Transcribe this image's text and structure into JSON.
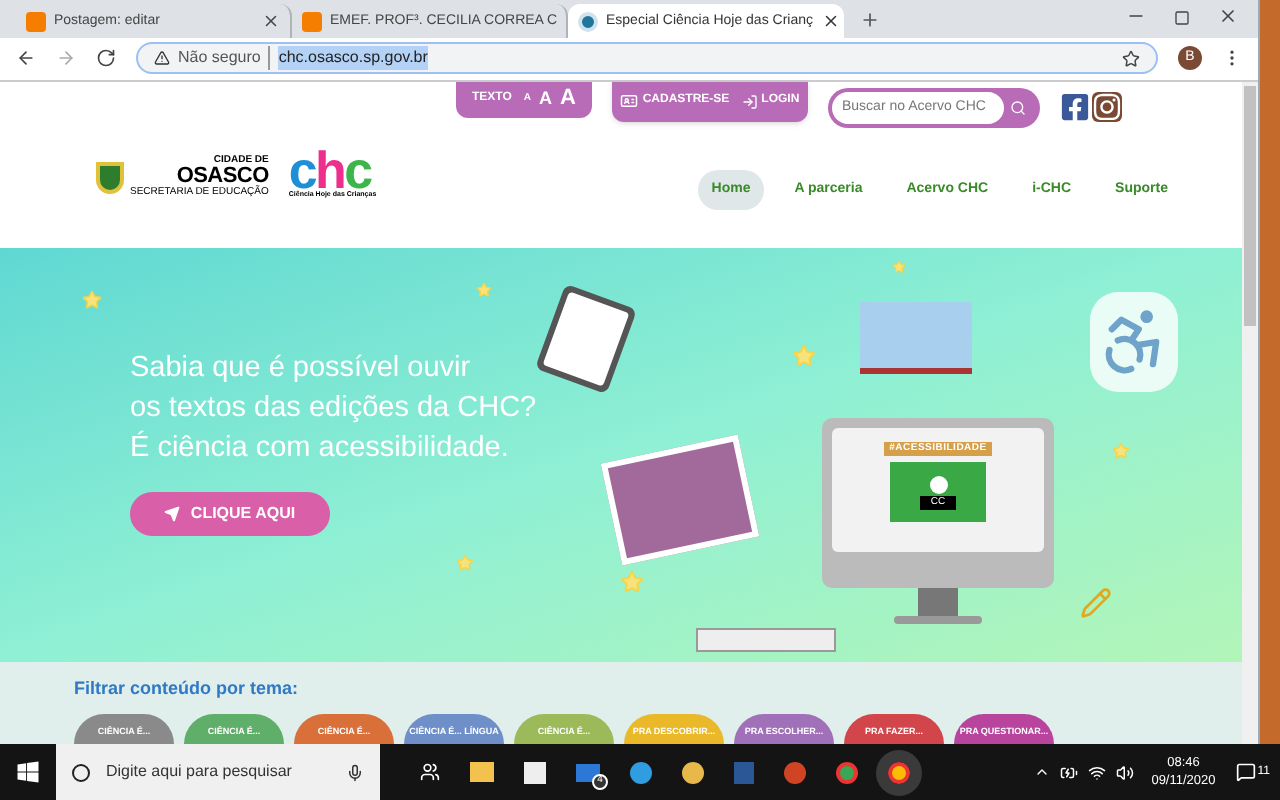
{
  "browser": {
    "tabs": [
      {
        "title": "Postagem: editar",
        "kind": "blogger",
        "selected": false
      },
      {
        "title": "EMEF. PROF³. CECILIA CORREA C",
        "kind": "blogger",
        "selected": false
      },
      {
        "title": "Especial Ciência Hoje das Crianç",
        "kind": "wordpress",
        "selected": true
      }
    ],
    "address": {
      "security": "Não seguro",
      "url": "chc.osasco.sp.gov.br",
      "url_selected": true
    },
    "profile": "B"
  },
  "header": {
    "text_size": {
      "label": "TEXTO",
      "sizes": [
        "A",
        "A",
        "A"
      ]
    },
    "account": [
      {
        "label": "CADASTRE-SE",
        "kind": "card"
      },
      {
        "label": "LOGIN",
        "kind": "login"
      }
    ],
    "search": {
      "placeholder": "Buscar no Acervo CHC"
    },
    "city_logo": {
      "top": "CIDADE DE",
      "name": "OSASCO",
      "bottom": "SECRETARIA DE EDUCAÇÃO"
    },
    "chc_logo": {
      "letters": [
        {
          "text": "c",
          "color": "#1e8fd6"
        },
        {
          "text": "h",
          "color": "#ec2f8c"
        },
        {
          "text": "c",
          "color": "#3cb54a"
        }
      ],
      "subtitle": "Ciência Hoje das Crianças"
    },
    "nav": [
      {
        "label": "Home",
        "selected": true
      },
      {
        "label": "A parceria",
        "selected": false
      },
      {
        "label": "Acervo CHC",
        "selected": false
      },
      {
        "label": "i-CHC",
        "selected": false
      },
      {
        "label": "Suporte",
        "selected": false
      }
    ]
  },
  "hero": {
    "lines": [
      "Sabia que é possível ouvir",
      "os textos das edições da CHC?",
      "É ciência com acessibilidade."
    ],
    "button": "CLIQUE AQUI",
    "screen_tag": "#ACESSIBILIDADE",
    "captions": "CC"
  },
  "filter": {
    "title": "Filtrar conteúdo por tema:",
    "chips": [
      {
        "label": "CIÊNCIA É...",
        "color": "#8a8a8a"
      },
      {
        "label": "CIÊNCIA É...",
        "color": "#5fae6a"
      },
      {
        "label": "CIÊNCIA É...",
        "color": "#d9703a"
      },
      {
        "label": "CIÊNCIA É... LÍNGUA",
        "color": "#6f8fc9"
      },
      {
        "label": "CIÊNCIA É...",
        "color": "#9cba5a"
      },
      {
        "label": "PRA DESCOBRIR...",
        "color": "#e9b92a"
      },
      {
        "label": "PRA ESCOLHER...",
        "color": "#a070b8"
      },
      {
        "label": "PRA FAZER...",
        "color": "#d2454a"
      },
      {
        "label": "PRA QUESTIONAR...",
        "color": "#b8449e"
      }
    ]
  },
  "taskbar": {
    "search": {
      "placeholder": "Digite aqui para pesquisar"
    },
    "mail_badge": "4",
    "time": "08:46",
    "date": "09/11/2020",
    "notifications": "11"
  }
}
